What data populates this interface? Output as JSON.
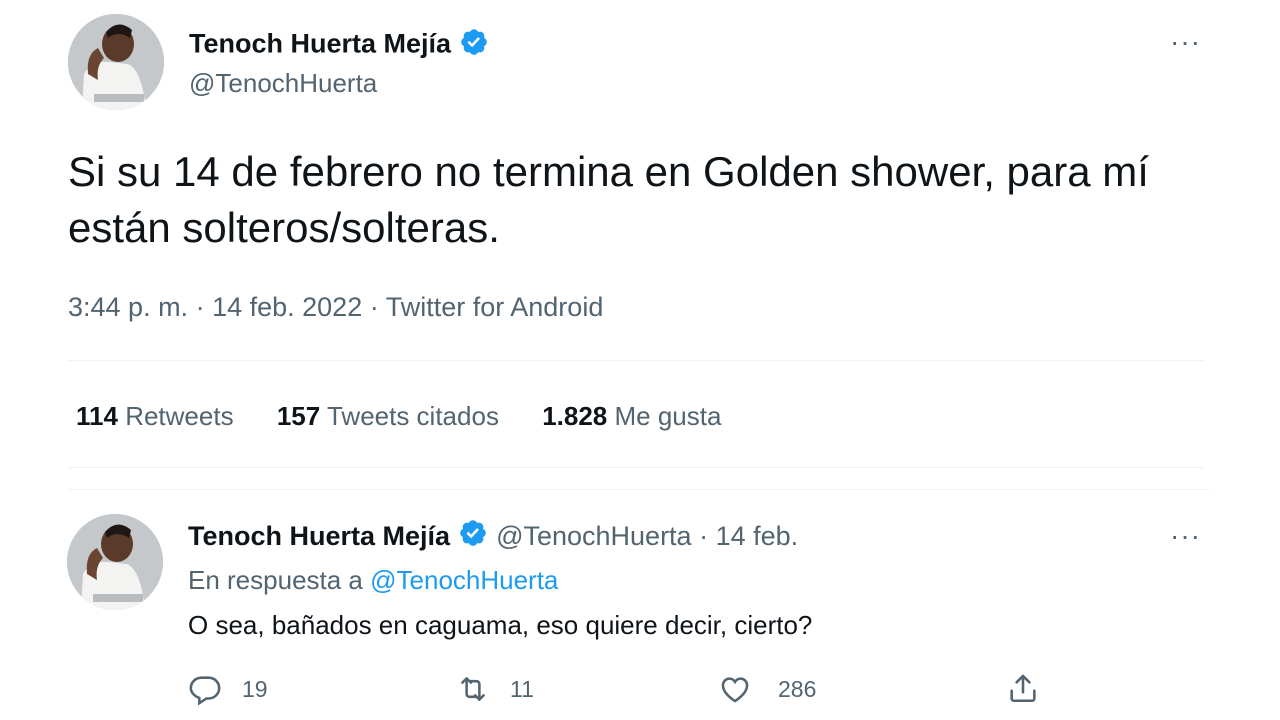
{
  "tweet": {
    "author_name": "Tenoch Huerta Mejía",
    "author_handle": "@TenochHuerta",
    "verified_icon": "verified-badge-icon",
    "more_label": "···",
    "text": "Si su 14 de febrero no termina en Golden shower, para mí están solteros/solteras.",
    "meta": {
      "time": "3:44 p. m.",
      "sep1": " · ",
      "date": "14 feb. 2022",
      "sep2": " · ",
      "source": "Twitter for Android"
    },
    "stats": {
      "retweets_count": "114",
      "retweets_label": "Retweets",
      "quotes_count": "157",
      "quotes_label": "Tweets citados",
      "likes_count": "1.828",
      "likes_label": "Me gusta"
    }
  },
  "reply": {
    "author_name": "Tenoch Huerta Mejía",
    "author_handle": "@TenochHuerta",
    "sep": " · ",
    "date": "14 feb.",
    "more_label": "···",
    "reply_to_prefix": "En respuesta a ",
    "reply_to_mention": "@TenochHuerta",
    "text": "O sea, bañados en caguama, eso quiere decir, cierto?",
    "actions": {
      "replies": "19",
      "retweets": "11",
      "likes": "286"
    }
  },
  "colors": {
    "accent": "#1d9bf0",
    "text": "#0f1419",
    "muted": "#536471",
    "divider": "#eff3f4"
  }
}
